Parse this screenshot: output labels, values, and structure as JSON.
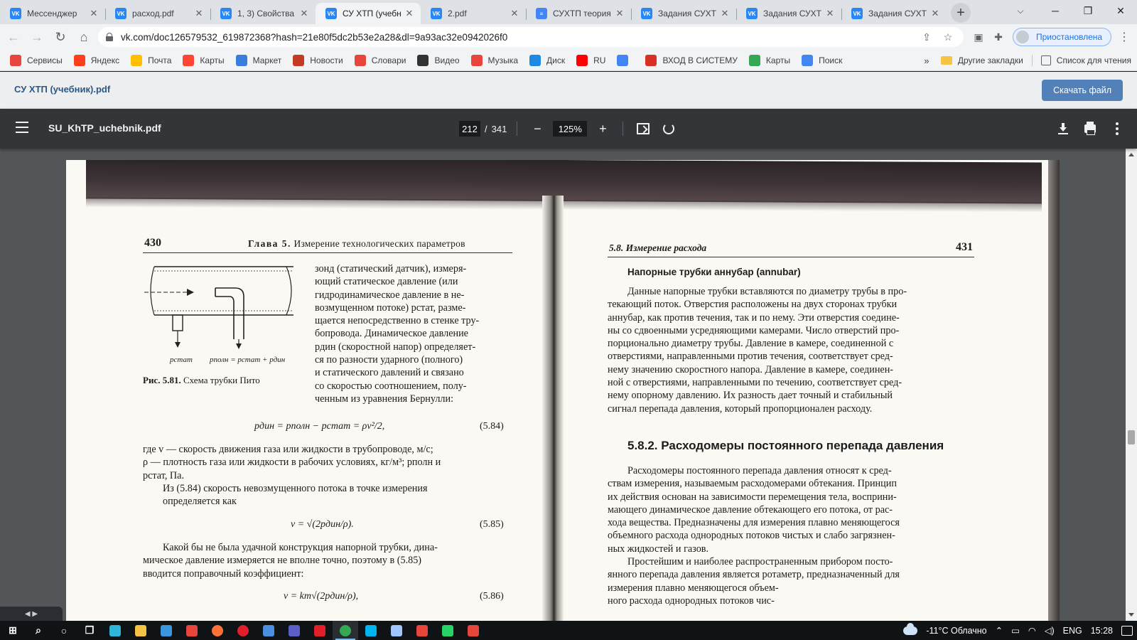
{
  "tabs": [
    {
      "title": "Мессенджер",
      "icon": "vk-messenger-icon",
      "color": "#2787f5"
    },
    {
      "title": "расход.pdf",
      "icon": "vk-icon",
      "color": "#2787f5"
    },
    {
      "title": "1, 3) Свойства",
      "icon": "vk-icon",
      "color": "#2787f5"
    },
    {
      "title": "СУ ХТП (учебн",
      "icon": "vk-icon",
      "color": "#2787f5",
      "active": true
    },
    {
      "title": "2.pdf",
      "icon": "vk-icon",
      "color": "#2787f5"
    },
    {
      "title": "СУХТП теория",
      "icon": "google-docs-icon",
      "color": "#4285f4"
    },
    {
      "title": "Задания СУХТ",
      "icon": "vk-icon",
      "color": "#2787f5"
    },
    {
      "title": "Задания СУХТ",
      "icon": "vk-icon",
      "color": "#2787f5"
    },
    {
      "title": "Задания СУХТ",
      "icon": "vk-icon",
      "color": "#2787f5"
    }
  ],
  "url": "vk.com/doc126579532_619872368?hash=21e80f5dc2b53e2a28&dl=9a93ac32e0942026f0",
  "profile_label": "Приостановлена",
  "bookmarks": [
    {
      "label": "Сервисы",
      "icon": "apps-grid-icon",
      "color": "#e8453c"
    },
    {
      "label": "Яндекс",
      "icon": "yandex-icon",
      "color": "#fc3f1d"
    },
    {
      "label": "Почта",
      "icon": "mail-icon",
      "color": "#ffbe00"
    },
    {
      "label": "Карты",
      "icon": "map-pin-icon",
      "color": "#ff4433"
    },
    {
      "label": "Маркет",
      "icon": "market-icon",
      "color": "#3b7ddd"
    },
    {
      "label": "Новости",
      "icon": "news-icon",
      "color": "#c23b22"
    },
    {
      "label": "Словари",
      "icon": "dictionary-icon",
      "color": "#e8453c"
    },
    {
      "label": "Видео",
      "icon": "video-play-icon",
      "color": "#333333"
    },
    {
      "label": "Музыка",
      "icon": "music-icon",
      "color": "#e8453c"
    },
    {
      "label": "Диск",
      "icon": "disk-icon",
      "color": "#1e88e5"
    },
    {
      "label": "RU",
      "icon": "youtube-icon",
      "color": "#ff0000"
    },
    {
      "label": "",
      "icon": "google-icon",
      "color": "#4285f4"
    },
    {
      "label": "ВХОД В СИСТЕМУ",
      "icon": "login-icon",
      "color": "#d93025"
    },
    {
      "label": "Карты",
      "icon": "google-maps-icon",
      "color": "#34a853"
    },
    {
      "label": "Поиск",
      "icon": "google-search-icon",
      "color": "#4285f4"
    }
  ],
  "bookmarks_more": "»",
  "other_bookmarks": "Другие закладки",
  "reading_list": "Список для чтения",
  "vk": {
    "doc_title": "СУ ХТП (учебник).pdf",
    "download_label": "Скачать файл"
  },
  "pdf": {
    "filename": "SU_KhTP_uchebnik.pdf",
    "current_page": "212",
    "total_pages": "341",
    "zoom": "125%"
  },
  "book": {
    "left": {
      "page_number": "430",
      "running_head_chapter": "Глава 5.",
      "running_head_title": "Измерение технологических параметров",
      "figure_labels": {
        "p_stat": "pстат",
        "p_full": "pполн = pстат + pдин"
      },
      "figure_caption_num": "Рис. 5.81.",
      "figure_caption_text": "Схема трубки Пито",
      "side_text": [
        "зонд (статический датчик), измеря-",
        "ющий статическое давление (или",
        "гидродинамическое давление в не-",
        "возмущенном потоке) pстат, разме-",
        "щается непосредственно в стенке тру-",
        "бопровода. Динамическое давление",
        "pдин (скоростной напор) определяет-",
        "ся по разности ударного (полного)",
        "и статического давлений и связано",
        "со скоростью соотношением, полу-",
        "ченным из уравнения Бернулли:"
      ],
      "eq_584": "pдин = pполн − pстат = ρv²/2,",
      "eq_584_num": "(5.84)",
      "where_text": [
        "где v — скорость движения газа или жидкости в трубопроводе, м/с;",
        "ρ — плотность газа или жидкости в рабочих условиях, кг/м³; pполн и",
        "pстат, Па."
      ],
      "from_text": [
        "Из (5.84) скорость невозмущенного потока в точке измерения",
        "определяется как"
      ],
      "eq_585": "v = √(2pдин/ρ).",
      "eq_585_num": "(5.85)",
      "whatever_text": [
        "Какой бы не была удачной конструкция напорной трубки, дина-",
        "мическое давление измеряется не вполне точно, поэтому в (5.85)",
        "вводится поправочный коэффициент:"
      ],
      "eq_586": "v = kт√(2pдин/ρ),",
      "eq_586_num": "(5.86)"
    },
    "right": {
      "page_number": "431",
      "running_head": "5.8. Измерение расхода",
      "subheading": "Напорные трубки аннубар (annubar)",
      "para1": [
        "Данные напорные трубки вставляются по диаметру трубы в про-",
        "текающий поток. Отверстия расположены на двух сторонах трубки",
        "аннубар, как против течения, так и по нему. Эти отверстия соедине-",
        "ны со сдвоенными усредняющими камерами. Число отверстий про-",
        "порционально диаметру трубы. Давление в камере, соединенной с",
        "отверстиями, направленными против течения, соответствует сред-",
        "нему значению скоростного напора. Давление в камере, соединен-",
        "ной с отверстиями, направленными по течению, соответствует сред-",
        "нему опорному давлению. Их разность дает точный и стабильный",
        "сигнал перепада давления, который пропорционален расходу."
      ],
      "section_heading": "5.8.2. Расходомеры постоянного перепада давления",
      "para2": [
        "Расходомеры постоянного перепада давления относят к сред-",
        "ствам измерения, называемым расходомерами обтекания. Принцип",
        "их действия основан на зависимости перемещения тела, восприни-",
        "мающего динамическое давление обтекающего его потока, от рас-",
        "хода вещества. Предназначены для измерения плавно меняющегося",
        "объемного расхода однородных потоков чистых и слабо загрязнен-",
        "ных жидкостей и газов."
      ],
      "para3": [
        "Простейшим и наиболее распространенным прибором посто-",
        "янного перепада давления является ротаметр, предназначенный для",
        "измерения плавно меняющегося объем-",
        "ного расхода однородных потоков чис-"
      ]
    }
  },
  "taskbar": {
    "apps": [
      {
        "icon": "windows-start-icon",
        "color": "#ffffff"
      },
      {
        "icon": "search-icon",
        "color": "#ffffff"
      },
      {
        "icon": "cortana-circle-icon",
        "color": "#ffffff"
      },
      {
        "icon": "task-view-icon",
        "color": "#ffffff"
      },
      {
        "icon": "edge-icon",
        "color": "#2fb5d9"
      },
      {
        "icon": "file-explorer-icon",
        "color": "#f6c344"
      },
      {
        "icon": "store-icon",
        "color": "#3a96dd"
      },
      {
        "icon": "yandex-browser-icon",
        "color": "#e8453c"
      },
      {
        "icon": "firefox-icon",
        "color": "#ff7139"
      },
      {
        "icon": "opera-icon",
        "color": "#e01f2a"
      },
      {
        "icon": "mail-app-icon",
        "color": "#4a8fe0"
      },
      {
        "icon": "floppy-app-icon",
        "color": "#5b5fc7"
      },
      {
        "icon": "opera-red-icon",
        "color": "#e01f2a"
      },
      {
        "icon": "chrome-icon",
        "color": "#34a853",
        "active": true
      },
      {
        "icon": "tiles-app-icon",
        "color": "#00b4ef"
      },
      {
        "icon": "notebook-app-icon",
        "color": "#a0c4ff"
      },
      {
        "icon": "yandex-music-icon",
        "color": "#e8453c"
      },
      {
        "icon": "whatsapp-icon",
        "color": "#25d366"
      },
      {
        "icon": "antivirus-app-icon",
        "color": "#e8453c"
      }
    ],
    "weather": "-11°C Облачно",
    "lang": "ENG",
    "time": "15:28"
  }
}
